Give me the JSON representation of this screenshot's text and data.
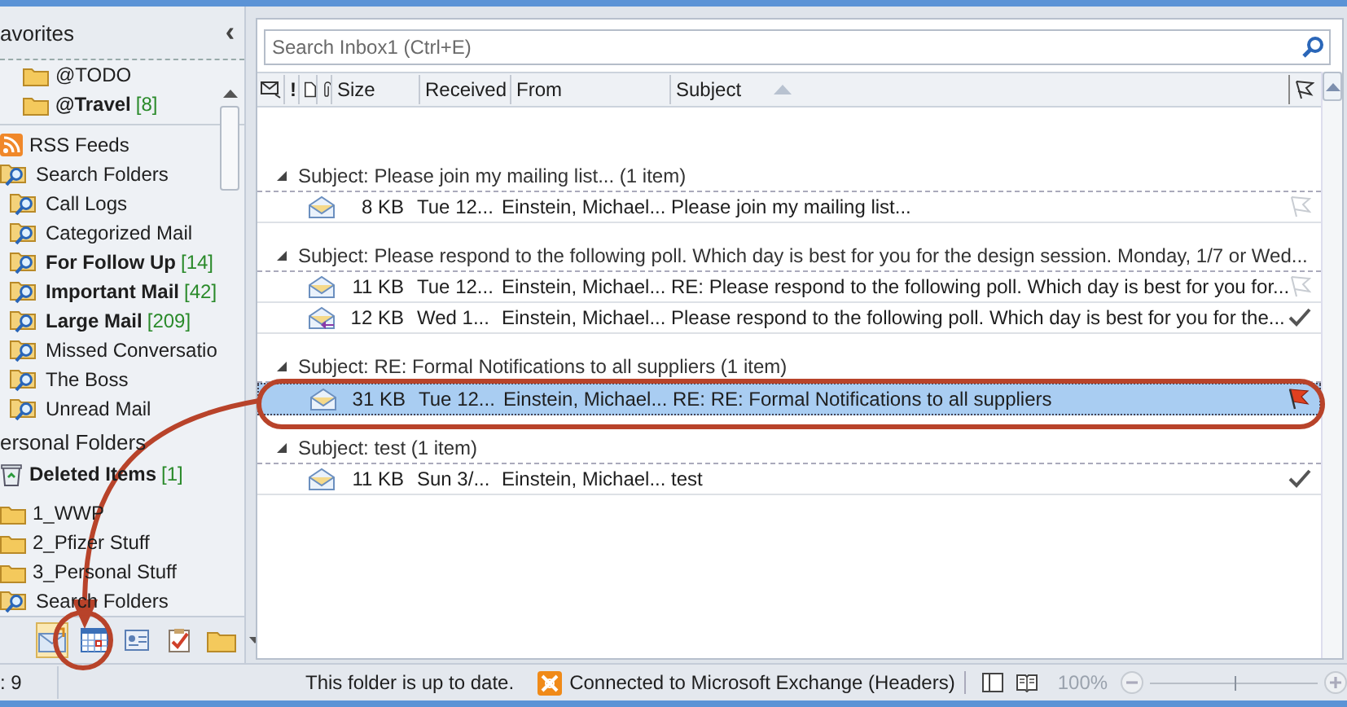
{
  "nav": {
    "collapse_glyph": "‹",
    "sections": [
      {
        "header": "avorites",
        "items": [
          {
            "label": "@TODO",
            "kind": "folder",
            "bold": false
          },
          {
            "label": "@Travel",
            "count": "[8]",
            "kind": "folder",
            "bold": true
          }
        ]
      },
      {
        "items": [
          {
            "label": "RSS Feeds",
            "kind": "rss",
            "bold": false
          },
          {
            "label": "Search Folders",
            "kind": "search-folder",
            "bold": false,
            "children": [
              {
                "label": "Call Logs",
                "kind": "search-folder",
                "bold": false
              },
              {
                "label": "Categorized Mail",
                "kind": "search-folder",
                "bold": false
              },
              {
                "label": "For Follow Up",
                "count": "[14]",
                "kind": "search-folder",
                "bold": true
              },
              {
                "label": "Important Mail",
                "count": "[42]",
                "kind": "search-folder",
                "bold": true
              },
              {
                "label": "Large Mail",
                "count": "[209]",
                "kind": "search-folder",
                "bold": true
              },
              {
                "label": "Missed Conversatio",
                "kind": "search-folder",
                "bold": false
              },
              {
                "label": "The Boss",
                "kind": "search-folder",
                "bold": false
              },
              {
                "label": "Unread Mail",
                "kind": "search-folder",
                "bold": false
              }
            ]
          }
        ]
      },
      {
        "header": "ersonal Folders",
        "items": [
          {
            "label": "Deleted Items",
            "count": "[1]",
            "kind": "trash",
            "bold": true
          },
          {
            "label": "1_WWP",
            "kind": "folder",
            "bold": false
          },
          {
            "label": "2_Pfizer Stuff",
            "kind": "folder",
            "bold": false
          },
          {
            "label": "3_Personal Stuff",
            "kind": "folder",
            "bold": false
          },
          {
            "label": "Search Folders",
            "kind": "search-folder",
            "bold": false
          }
        ]
      }
    ]
  },
  "nav_buttons": [
    {
      "kind": "mail",
      "selected": true
    },
    {
      "kind": "calendar",
      "selected": false
    },
    {
      "kind": "contacts",
      "selected": false
    },
    {
      "kind": "tasks",
      "selected": false
    },
    {
      "kind": "folder",
      "selected": false
    },
    {
      "kind": "more",
      "selected": false
    }
  ],
  "search": {
    "placeholder": "Search Inbox1 (Ctrl+E)"
  },
  "columns": [
    {
      "kind": "icon-envelope"
    },
    {
      "kind": "importance",
      "label": "!"
    },
    {
      "kind": "icon-doc"
    },
    {
      "kind": "icon-clip"
    },
    {
      "kind": "text",
      "label": "Size"
    },
    {
      "kind": "text",
      "label": "Received"
    },
    {
      "kind": "text",
      "label": "From"
    },
    {
      "kind": "text",
      "label": "Subject",
      "sorted": true
    },
    {
      "kind": "icon-flag"
    }
  ],
  "groups": [
    {
      "header": "Subject: Please join my mailing list... (1 item)",
      "expanded": true,
      "rows": [
        {
          "kind": "read",
          "size": "8 KB",
          "received": "Tue 12...",
          "from": "Einstein, Michael...",
          "subject": "Please join my mailing list...",
          "flagged": false,
          "completed": false,
          "selected": false
        }
      ]
    },
    {
      "header": "Subject: Please respond to the following poll.  Which day is best for you for the design session.  Monday, 1/7 or Wed...",
      "expanded": true,
      "rows": [
        {
          "kind": "read",
          "size": "11 KB",
          "received": "Tue 12...",
          "from": "Einstein, Michael...",
          "subject": "RE: Please respond to the following poll.  Which day is best for you for...",
          "flagged": false,
          "completed": false,
          "selected": false
        },
        {
          "kind": "replied",
          "size": "12 KB",
          "received": "Wed 1...",
          "from": "Einstein, Michael...",
          "subject": "Please respond to the following poll.  Which day is best for you for the...",
          "flagged": false,
          "completed": true,
          "selected": false
        }
      ]
    },
    {
      "header": "Subject: RE: Formal Notifications to all suppliers (1 item)",
      "expanded": true,
      "rows": [
        {
          "kind": "read",
          "size": "31 KB",
          "received": "Tue 12...",
          "from": "Einstein, Michael...",
          "subject": "RE: RE: Formal Notifications to all suppliers",
          "flagged": true,
          "completed": false,
          "selected": true
        }
      ]
    },
    {
      "header": "Subject: test (1 item)",
      "expanded": true,
      "rows": [
        {
          "kind": "read",
          "size": "11 KB",
          "received": "Sun 3/...",
          "from": "Einstein, Michael...",
          "subject": "test",
          "flagged": false,
          "completed": true,
          "selected": false
        }
      ]
    }
  ],
  "status_bar": {
    "items_count": ": 9",
    "sync": "This folder is up to date.",
    "connection": "Connected to Microsoft Exchange (Headers)",
    "zoom": "100%",
    "zoom_slider": {
      "level": 0.5
    }
  }
}
